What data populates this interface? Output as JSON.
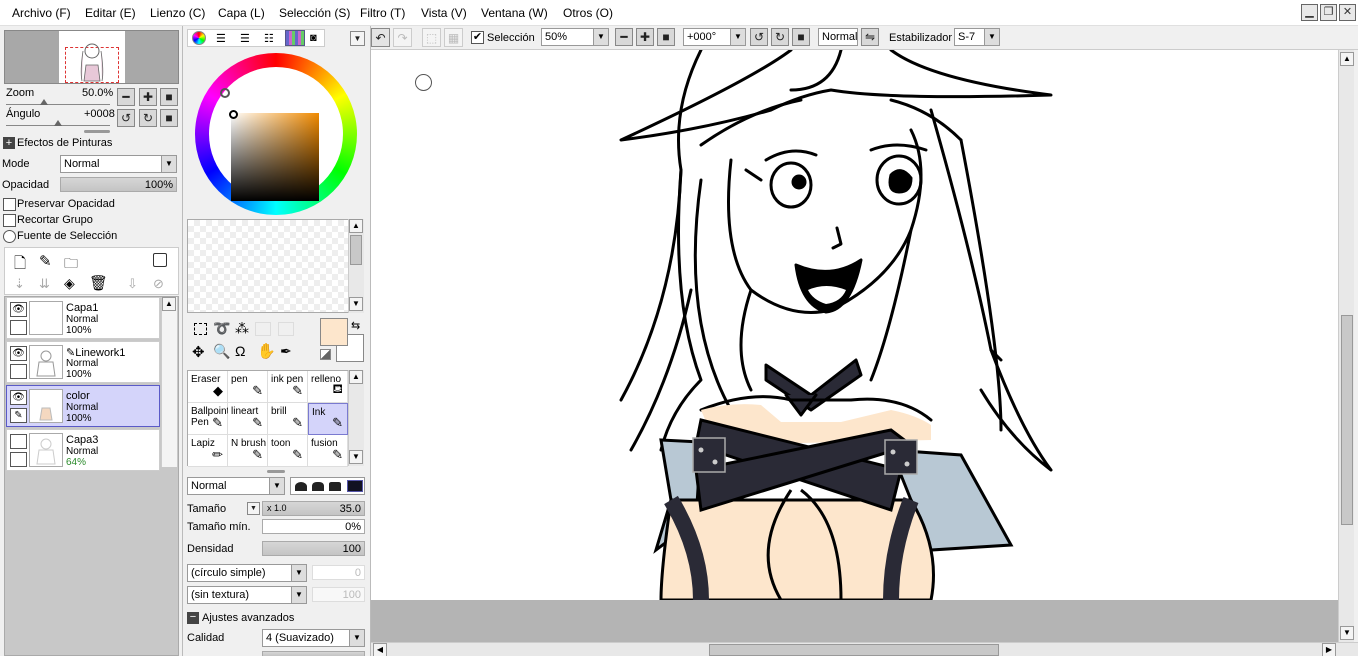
{
  "menu": [
    "Archivo (F)",
    "Editar (E)",
    "Lienzo (C)",
    "Capa (L)",
    "Selección (S)",
    "Filtro (T)",
    "Vista (V)",
    "Ventana (W)",
    "Otros (O)"
  ],
  "window_controls": {
    "minimize": "▁",
    "restore": "❐",
    "close": "✕"
  },
  "navigator": {
    "zoom_label": "Zoom",
    "zoom_value": "50.0%",
    "angle_label": "Ángulo",
    "angle_value": "+0008"
  },
  "paint_effects": {
    "title": "Efectos de Pinturas",
    "mode_label": "Mode",
    "mode_value": "Normal",
    "opacity_label": "Opacidad",
    "opacity_value": "100%",
    "preserve_opacity": "Preservar Opacidad",
    "clip_group": "Recortar Grupo",
    "selection_source": "Fuente de Selección"
  },
  "layers": [
    {
      "name": "Capa1",
      "mode": "Normal",
      "opacity": "100%",
      "selected": false
    },
    {
      "name": "Linework1",
      "mode": "Normal",
      "opacity": "100%",
      "selected": false
    },
    {
      "name": "color",
      "mode": "Normal",
      "opacity": "100%",
      "selected": true
    },
    {
      "name": "Capa3",
      "mode": "Normal",
      "opacity": "64%",
      "selected": false
    }
  ],
  "tools": [
    {
      "name": "Eraser",
      "icon": "eraser-icon"
    },
    {
      "name": "pen",
      "icon": "pen-icon"
    },
    {
      "name": "ink pen",
      "icon": "pen-icon"
    },
    {
      "name": "relleno",
      "icon": "bucket-icon"
    },
    {
      "name": "Ballpoint Pen",
      "icon": "pen-icon"
    },
    {
      "name": "lineart",
      "icon": "pen-icon"
    },
    {
      "name": "brill",
      "icon": "pen-icon"
    },
    {
      "name": "Ink",
      "icon": "pen-icon",
      "selected": true
    },
    {
      "name": "Lapiz",
      "icon": "pencil-icon"
    },
    {
      "name": "N brush",
      "icon": "brush-icon"
    },
    {
      "name": "toon",
      "icon": "pen-icon"
    },
    {
      "name": "fusion",
      "icon": "brush-icon"
    }
  ],
  "brush": {
    "blend_mode": "Normal",
    "size_label": "Tamaño",
    "size_mult": "x 1.0",
    "size_value": "35.0",
    "min_size_label": "Tamaño mín.",
    "min_size_value": "0%",
    "density_label": "Densidad",
    "density_value": "100",
    "shape": "(círculo simple)",
    "shape_value": "0",
    "texture": "(sin textura)",
    "texture_value": "100",
    "advanced": "Ajustes avanzados",
    "quality_label": "Calidad",
    "quality_value": "4 (Suavizado)"
  },
  "toolbar": {
    "selection_label": "Selección",
    "zoom": "50%",
    "angle": "+000°",
    "blend": "Normal",
    "stabilizer_label": "Estabilizador",
    "stabilizer_value": "S-7"
  },
  "colors": {
    "accent": "#5a5ac8",
    "foreground": "#fde6cc",
    "background": "#ffffff",
    "canvas_bg": "#b4b4b4"
  }
}
